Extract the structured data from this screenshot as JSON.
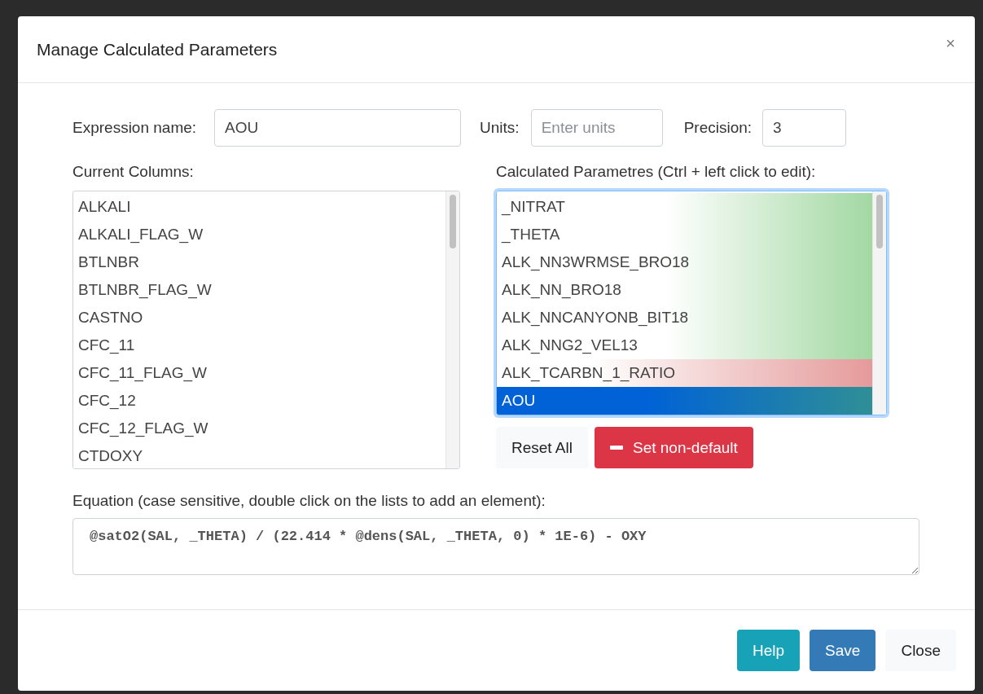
{
  "dialog": {
    "title": "Manage Calculated Parameters",
    "close_symbol": "×"
  },
  "expression": {
    "label": "Expression name:",
    "value": "AOU"
  },
  "units": {
    "label": "Units:",
    "placeholder": "Enter units"
  },
  "precision": {
    "label": "Precision:",
    "value": "3"
  },
  "current_columns": {
    "label": "Current Columns:",
    "items": [
      {
        "label": "ALKALI"
      },
      {
        "label": "ALKALI_FLAG_W"
      },
      {
        "label": "BTLNBR"
      },
      {
        "label": "BTLNBR_FLAG_W"
      },
      {
        "label": "CASTNO"
      },
      {
        "label": "CFC_11"
      },
      {
        "label": "CFC_11_FLAG_W"
      },
      {
        "label": "CFC_12"
      },
      {
        "label": "CFC_12_FLAG_W"
      },
      {
        "label": "CTDOXY"
      }
    ]
  },
  "calculated": {
    "label": "Calculated Parametres (Ctrl + left click to edit):",
    "items": [
      {
        "label": "_NITRAT",
        "kind": "valid",
        "selected": false
      },
      {
        "label": "_THETA",
        "kind": "valid",
        "selected": false
      },
      {
        "label": "ALK_NN3WRMSE_BRO18",
        "kind": "valid",
        "selected": false
      },
      {
        "label": "ALK_NN_BRO18",
        "kind": "valid",
        "selected": false
      },
      {
        "label": "ALK_NNCANYONB_BIT18",
        "kind": "valid",
        "selected": false
      },
      {
        "label": "ALK_NNG2_VEL13",
        "kind": "valid",
        "selected": false
      },
      {
        "label": "ALK_TCARBN_1_RATIO",
        "kind": "invalid",
        "selected": false
      },
      {
        "label": "AOU",
        "kind": "valid",
        "selected": true
      }
    ]
  },
  "list_buttons": {
    "reset": "Reset All",
    "set_non_default": "Set non-default"
  },
  "equation": {
    "label": "Equation (case sensitive, double click on the lists to add an element):",
    "value": "@satO2(SAL, _THETA) / (22.414 * @dens(SAL, _THETA, 0) * 1E-6) - OXY"
  },
  "footer_buttons": [
    {
      "label": "Help",
      "kind": "info"
    },
    {
      "label": "Save",
      "kind": "primary"
    },
    {
      "label": "Close",
      "kind": "light"
    }
  ]
}
